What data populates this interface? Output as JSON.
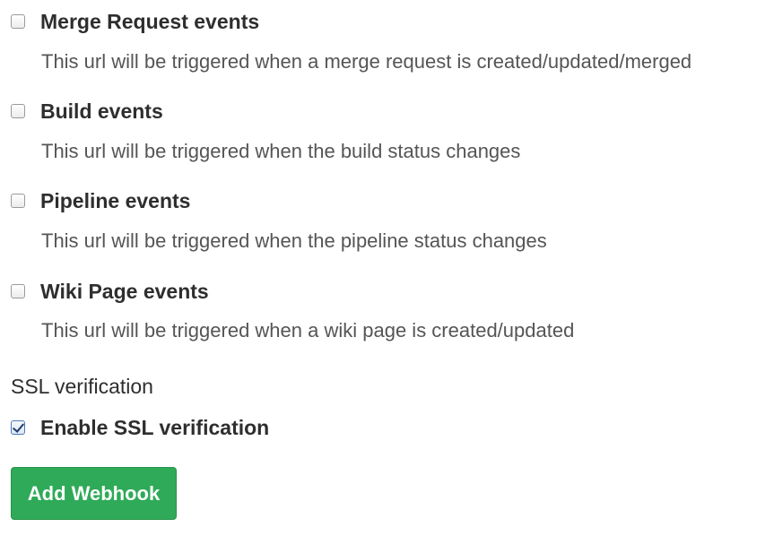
{
  "events": [
    {
      "label": "Merge Request events",
      "description": "This url will be triggered when a merge request is created/updated/merged",
      "checked": false
    },
    {
      "label": "Build events",
      "description": "This url will be triggered when the build status changes",
      "checked": false
    },
    {
      "label": "Pipeline events",
      "description": "This url will be triggered when the pipeline status changes",
      "checked": false
    },
    {
      "label": "Wiki Page events",
      "description": "This url will be triggered when a wiki page is created/updated",
      "checked": false
    }
  ],
  "ssl": {
    "section_label": "SSL verification",
    "checkbox_label": "Enable SSL verification",
    "checked": true
  },
  "submit": {
    "label": "Add Webhook"
  },
  "colors": {
    "primary_button": "#2faa58",
    "text": "#2e2e2e",
    "description_text": "#555555"
  }
}
